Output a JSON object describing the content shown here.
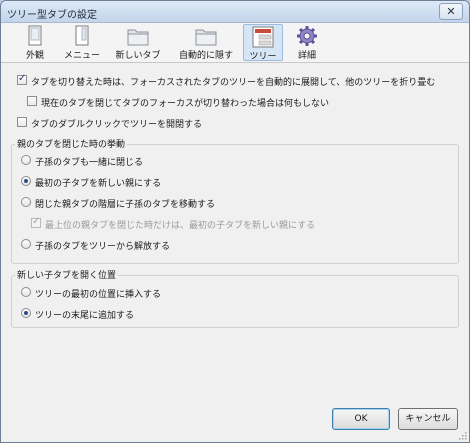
{
  "window": {
    "title": "ツリー型タブの設定",
    "close_label": "✕"
  },
  "toolbar": {
    "tabs": [
      {
        "label": "外観",
        "icon": "appearance-icon"
      },
      {
        "label": "メニュー",
        "icon": "menu-icon"
      },
      {
        "label": "新しいタブ",
        "icon": "folder-icon"
      },
      {
        "label": "自動的に隠す",
        "icon": "folder-icon"
      },
      {
        "label": "ツリー",
        "icon": "tree-icon",
        "selected": true
      },
      {
        "label": "詳細",
        "icon": "gear-icon"
      }
    ]
  },
  "options": {
    "auto_expand": {
      "label": "タブを切り替えた時は、フォーカスされたタブのツリーを自動的に展開して、他のツリーを折り畳む",
      "checked": true
    },
    "no_expand_on_close": {
      "label": "現在のタブを閉じてタブのフォーカスが切り替わった場合は何もしない",
      "checked": false
    },
    "dblclick_toggle": {
      "label": "タブのダブルクリックでツリーを開閉する",
      "checked": false
    }
  },
  "close_parent_group": {
    "legend": "親のタブを閉じた時の挙動",
    "choices": [
      {
        "label": "子孫のタブも一緒に閉じる",
        "checked": false
      },
      {
        "label": "最初の子タブを新しい親にする",
        "checked": true
      },
      {
        "label": "閉じた親タブの階層に子孫のタブを移動する",
        "checked": false
      },
      {
        "label": "子孫のタブをツリーから解放する",
        "checked": false
      }
    ],
    "sub_option": {
      "label": "最上位の親タブを閉じた時だけは、最初の子タブを新しい親にする",
      "checked": true,
      "disabled": true
    }
  },
  "new_child_group": {
    "legend": "新しい子タブを開く位置",
    "choices": [
      {
        "label": "ツリーの最初の位置に挿入する",
        "checked": false
      },
      {
        "label": "ツリーの末尾に追加する",
        "checked": true
      }
    ]
  },
  "buttons": {
    "ok": "OK",
    "cancel": "キャンセル"
  },
  "colors": {
    "accent": "#2d4b8e",
    "selected_tab_bg": "#d6e6f7",
    "titlebar": "#c3d5ec"
  }
}
